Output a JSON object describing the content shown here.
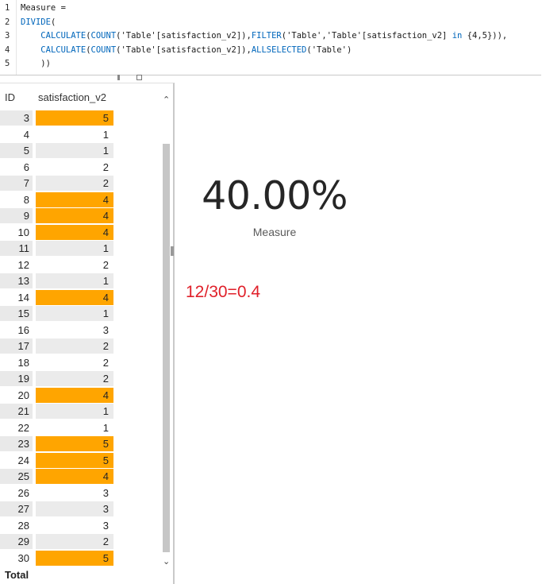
{
  "editor": {
    "lines": [
      {
        "num": "1",
        "parts": [
          {
            "t": "Measure =",
            "k": false
          }
        ]
      },
      {
        "num": "2",
        "parts": [
          {
            "t": "DIVIDE",
            "k": true
          },
          {
            "t": "(",
            "k": false
          }
        ]
      },
      {
        "num": "3",
        "parts": [
          {
            "t": "    ",
            "k": false
          },
          {
            "t": "CALCULATE",
            "k": true
          },
          {
            "t": "(",
            "k": false
          },
          {
            "t": "COUNT",
            "k": true
          },
          {
            "t": "('Table'[satisfaction_v2]),",
            "k": false
          },
          {
            "t": "FILTER",
            "k": true
          },
          {
            "t": "('Table','Table'[satisfaction_v2] ",
            "k": false
          },
          {
            "t": "in",
            "k": true
          },
          {
            "t": " {4,5})),",
            "k": false
          }
        ]
      },
      {
        "num": "4",
        "parts": [
          {
            "t": "    ",
            "k": false
          },
          {
            "t": "CALCULATE",
            "k": true
          },
          {
            "t": "(",
            "k": false
          },
          {
            "t": "COUNT",
            "k": true
          },
          {
            "t": "('Table'[satisfaction_v2]),",
            "k": false
          },
          {
            "t": "ALLSELECTED",
            "k": true
          },
          {
            "t": "('Table')",
            "k": false
          }
        ]
      },
      {
        "num": "5",
        "parts": [
          {
            "t": "    ))",
            "k": false
          }
        ]
      }
    ]
  },
  "table": {
    "columns": [
      "ID",
      "satisfaction_v2"
    ],
    "highlight_color": "#FFA500",
    "rows": [
      {
        "id": "3",
        "value": "5",
        "hl": true
      },
      {
        "id": "4",
        "value": "1",
        "hl": false
      },
      {
        "id": "5",
        "value": "1",
        "hl": false
      },
      {
        "id": "6",
        "value": "2",
        "hl": false
      },
      {
        "id": "7",
        "value": "2",
        "hl": false
      },
      {
        "id": "8",
        "value": "4",
        "hl": true
      },
      {
        "id": "9",
        "value": "4",
        "hl": true
      },
      {
        "id": "10",
        "value": "4",
        "hl": true
      },
      {
        "id": "11",
        "value": "1",
        "hl": false
      },
      {
        "id": "12",
        "value": "2",
        "hl": false
      },
      {
        "id": "13",
        "value": "1",
        "hl": false
      },
      {
        "id": "14",
        "value": "4",
        "hl": true
      },
      {
        "id": "15",
        "value": "1",
        "hl": false
      },
      {
        "id": "16",
        "value": "3",
        "hl": false
      },
      {
        "id": "17",
        "value": "2",
        "hl": false
      },
      {
        "id": "18",
        "value": "2",
        "hl": false
      },
      {
        "id": "19",
        "value": "2",
        "hl": false
      },
      {
        "id": "20",
        "value": "4",
        "hl": true
      },
      {
        "id": "21",
        "value": "1",
        "hl": false
      },
      {
        "id": "22",
        "value": "1",
        "hl": false
      },
      {
        "id": "23",
        "value": "5",
        "hl": true
      },
      {
        "id": "24",
        "value": "5",
        "hl": true
      },
      {
        "id": "25",
        "value": "4",
        "hl": true
      },
      {
        "id": "26",
        "value": "3",
        "hl": false
      },
      {
        "id": "27",
        "value": "3",
        "hl": false
      },
      {
        "id": "28",
        "value": "3",
        "hl": false
      },
      {
        "id": "29",
        "value": "2",
        "hl": false
      },
      {
        "id": "30",
        "value": "5",
        "hl": true
      }
    ],
    "total_label": "Total",
    "scroll_up_icon": "chevron-up-icon",
    "scroll_down_icon": "chevron-down-icon"
  },
  "card": {
    "value": "40.00%",
    "label": "Measure"
  },
  "annotation": {
    "text": "12/30=0.4",
    "color": "#E0202A"
  }
}
